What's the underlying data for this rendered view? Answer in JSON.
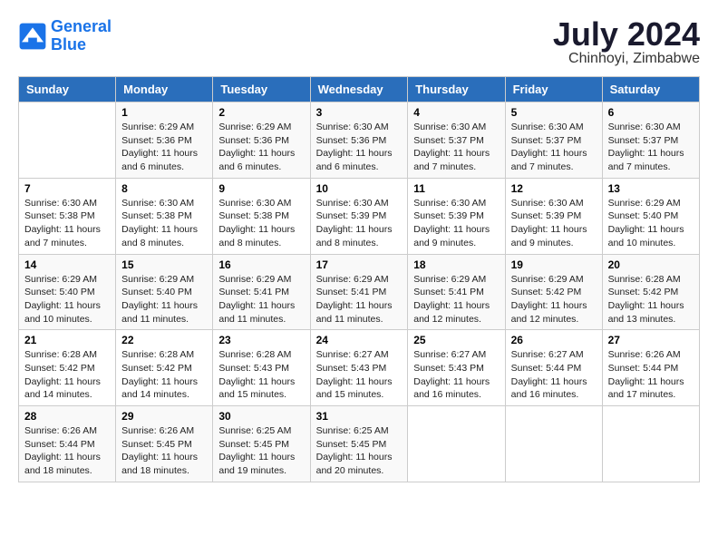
{
  "header": {
    "logo_line1": "General",
    "logo_line2": "Blue",
    "month": "July 2024",
    "location": "Chinhoyi, Zimbabwe"
  },
  "weekdays": [
    "Sunday",
    "Monday",
    "Tuesday",
    "Wednesday",
    "Thursday",
    "Friday",
    "Saturday"
  ],
  "weeks": [
    [
      {
        "day": "",
        "sunrise": "",
        "sunset": "",
        "daylight": ""
      },
      {
        "day": "1",
        "sunrise": "Sunrise: 6:29 AM",
        "sunset": "Sunset: 5:36 PM",
        "daylight": "Daylight: 11 hours and 6 minutes."
      },
      {
        "day": "2",
        "sunrise": "Sunrise: 6:29 AM",
        "sunset": "Sunset: 5:36 PM",
        "daylight": "Daylight: 11 hours and 6 minutes."
      },
      {
        "day": "3",
        "sunrise": "Sunrise: 6:30 AM",
        "sunset": "Sunset: 5:36 PM",
        "daylight": "Daylight: 11 hours and 6 minutes."
      },
      {
        "day": "4",
        "sunrise": "Sunrise: 6:30 AM",
        "sunset": "Sunset: 5:37 PM",
        "daylight": "Daylight: 11 hours and 7 minutes."
      },
      {
        "day": "5",
        "sunrise": "Sunrise: 6:30 AM",
        "sunset": "Sunset: 5:37 PM",
        "daylight": "Daylight: 11 hours and 7 minutes."
      },
      {
        "day": "6",
        "sunrise": "Sunrise: 6:30 AM",
        "sunset": "Sunset: 5:37 PM",
        "daylight": "Daylight: 11 hours and 7 minutes."
      }
    ],
    [
      {
        "day": "7",
        "sunrise": "Sunrise: 6:30 AM",
        "sunset": "Sunset: 5:38 PM",
        "daylight": "Daylight: 11 hours and 7 minutes."
      },
      {
        "day": "8",
        "sunrise": "Sunrise: 6:30 AM",
        "sunset": "Sunset: 5:38 PM",
        "daylight": "Daylight: 11 hours and 8 minutes."
      },
      {
        "day": "9",
        "sunrise": "Sunrise: 6:30 AM",
        "sunset": "Sunset: 5:38 PM",
        "daylight": "Daylight: 11 hours and 8 minutes."
      },
      {
        "day": "10",
        "sunrise": "Sunrise: 6:30 AM",
        "sunset": "Sunset: 5:39 PM",
        "daylight": "Daylight: 11 hours and 8 minutes."
      },
      {
        "day": "11",
        "sunrise": "Sunrise: 6:30 AM",
        "sunset": "Sunset: 5:39 PM",
        "daylight": "Daylight: 11 hours and 9 minutes."
      },
      {
        "day": "12",
        "sunrise": "Sunrise: 6:30 AM",
        "sunset": "Sunset: 5:39 PM",
        "daylight": "Daylight: 11 hours and 9 minutes."
      },
      {
        "day": "13",
        "sunrise": "Sunrise: 6:29 AM",
        "sunset": "Sunset: 5:40 PM",
        "daylight": "Daylight: 11 hours and 10 minutes."
      }
    ],
    [
      {
        "day": "14",
        "sunrise": "Sunrise: 6:29 AM",
        "sunset": "Sunset: 5:40 PM",
        "daylight": "Daylight: 11 hours and 10 minutes."
      },
      {
        "day": "15",
        "sunrise": "Sunrise: 6:29 AM",
        "sunset": "Sunset: 5:40 PM",
        "daylight": "Daylight: 11 hours and 11 minutes."
      },
      {
        "day": "16",
        "sunrise": "Sunrise: 6:29 AM",
        "sunset": "Sunset: 5:41 PM",
        "daylight": "Daylight: 11 hours and 11 minutes."
      },
      {
        "day": "17",
        "sunrise": "Sunrise: 6:29 AM",
        "sunset": "Sunset: 5:41 PM",
        "daylight": "Daylight: 11 hours and 11 minutes."
      },
      {
        "day": "18",
        "sunrise": "Sunrise: 6:29 AM",
        "sunset": "Sunset: 5:41 PM",
        "daylight": "Daylight: 11 hours and 12 minutes."
      },
      {
        "day": "19",
        "sunrise": "Sunrise: 6:29 AM",
        "sunset": "Sunset: 5:42 PM",
        "daylight": "Daylight: 11 hours and 12 minutes."
      },
      {
        "day": "20",
        "sunrise": "Sunrise: 6:28 AM",
        "sunset": "Sunset: 5:42 PM",
        "daylight": "Daylight: 11 hours and 13 minutes."
      }
    ],
    [
      {
        "day": "21",
        "sunrise": "Sunrise: 6:28 AM",
        "sunset": "Sunset: 5:42 PM",
        "daylight": "Daylight: 11 hours and 14 minutes."
      },
      {
        "day": "22",
        "sunrise": "Sunrise: 6:28 AM",
        "sunset": "Sunset: 5:42 PM",
        "daylight": "Daylight: 11 hours and 14 minutes."
      },
      {
        "day": "23",
        "sunrise": "Sunrise: 6:28 AM",
        "sunset": "Sunset: 5:43 PM",
        "daylight": "Daylight: 11 hours and 15 minutes."
      },
      {
        "day": "24",
        "sunrise": "Sunrise: 6:27 AM",
        "sunset": "Sunset: 5:43 PM",
        "daylight": "Daylight: 11 hours and 15 minutes."
      },
      {
        "day": "25",
        "sunrise": "Sunrise: 6:27 AM",
        "sunset": "Sunset: 5:43 PM",
        "daylight": "Daylight: 11 hours and 16 minutes."
      },
      {
        "day": "26",
        "sunrise": "Sunrise: 6:27 AM",
        "sunset": "Sunset: 5:44 PM",
        "daylight": "Daylight: 11 hours and 16 minutes."
      },
      {
        "day": "27",
        "sunrise": "Sunrise: 6:26 AM",
        "sunset": "Sunset: 5:44 PM",
        "daylight": "Daylight: 11 hours and 17 minutes."
      }
    ],
    [
      {
        "day": "28",
        "sunrise": "Sunrise: 6:26 AM",
        "sunset": "Sunset: 5:44 PM",
        "daylight": "Daylight: 11 hours and 18 minutes."
      },
      {
        "day": "29",
        "sunrise": "Sunrise: 6:26 AM",
        "sunset": "Sunset: 5:45 PM",
        "daylight": "Daylight: 11 hours and 18 minutes."
      },
      {
        "day": "30",
        "sunrise": "Sunrise: 6:25 AM",
        "sunset": "Sunset: 5:45 PM",
        "daylight": "Daylight: 11 hours and 19 minutes."
      },
      {
        "day": "31",
        "sunrise": "Sunrise: 6:25 AM",
        "sunset": "Sunset: 5:45 PM",
        "daylight": "Daylight: 11 hours and 20 minutes."
      },
      {
        "day": "",
        "sunrise": "",
        "sunset": "",
        "daylight": ""
      },
      {
        "day": "",
        "sunrise": "",
        "sunset": "",
        "daylight": ""
      },
      {
        "day": "",
        "sunrise": "",
        "sunset": "",
        "daylight": ""
      }
    ]
  ]
}
